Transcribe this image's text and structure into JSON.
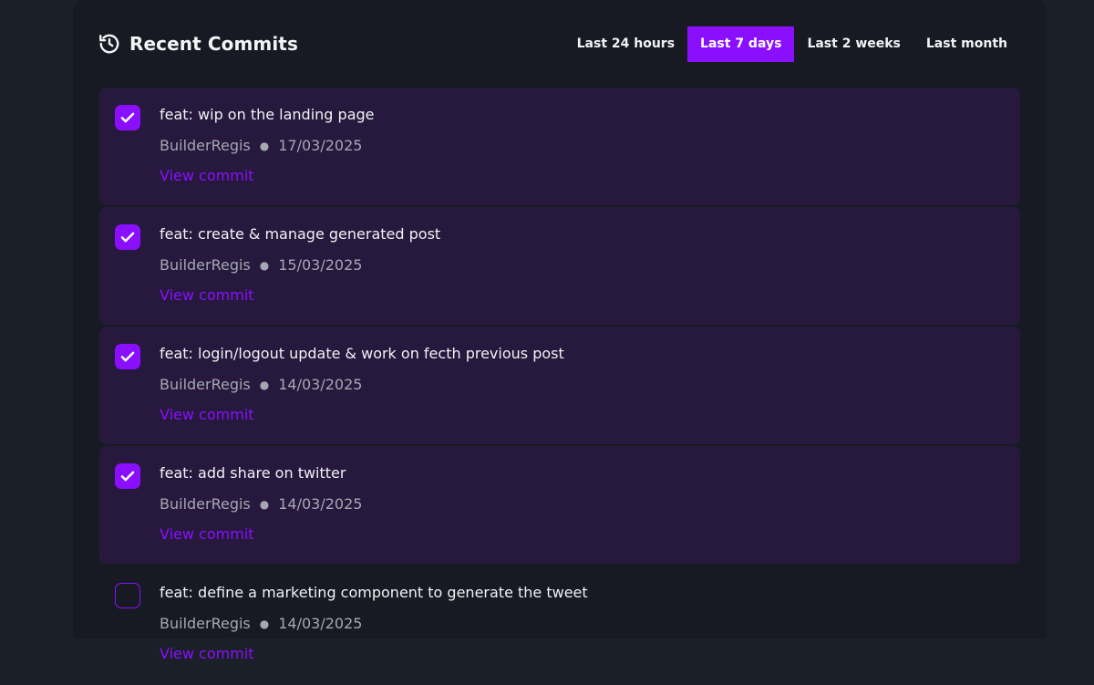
{
  "header": {
    "title": "Recent Commits",
    "icon": "history-icon"
  },
  "filters": [
    {
      "label": "Last 24 hours",
      "active": false
    },
    {
      "label": "Last 7 days",
      "active": true
    },
    {
      "label": "Last 2 weeks",
      "active": false
    },
    {
      "label": "Last month",
      "active": false
    }
  ],
  "colors": {
    "accent": "#8a0fff",
    "card_bg": "#26193d",
    "panel_bg": "#171a23",
    "page_bg": "#1b1f27"
  },
  "commits": [
    {
      "message": "feat: wip on the landing page",
      "author": "BuilderRegis",
      "date": "17/03/2025",
      "link_label": "View commit",
      "checked": true
    },
    {
      "message": "feat: create & manage generated post",
      "author": "BuilderRegis",
      "date": "15/03/2025",
      "link_label": "View commit",
      "checked": true
    },
    {
      "message": "feat: login/logout update & work on fecth previous post",
      "author": "BuilderRegis",
      "date": "14/03/2025",
      "link_label": "View commit",
      "checked": true
    },
    {
      "message": "feat: add share on twitter",
      "author": "BuilderRegis",
      "date": "14/03/2025",
      "link_label": "View commit",
      "checked": true
    },
    {
      "message": "feat: define a marketing component to generate the tweet",
      "author": "BuilderRegis",
      "date": "14/03/2025",
      "link_label": "View commit",
      "checked": false
    }
  ]
}
